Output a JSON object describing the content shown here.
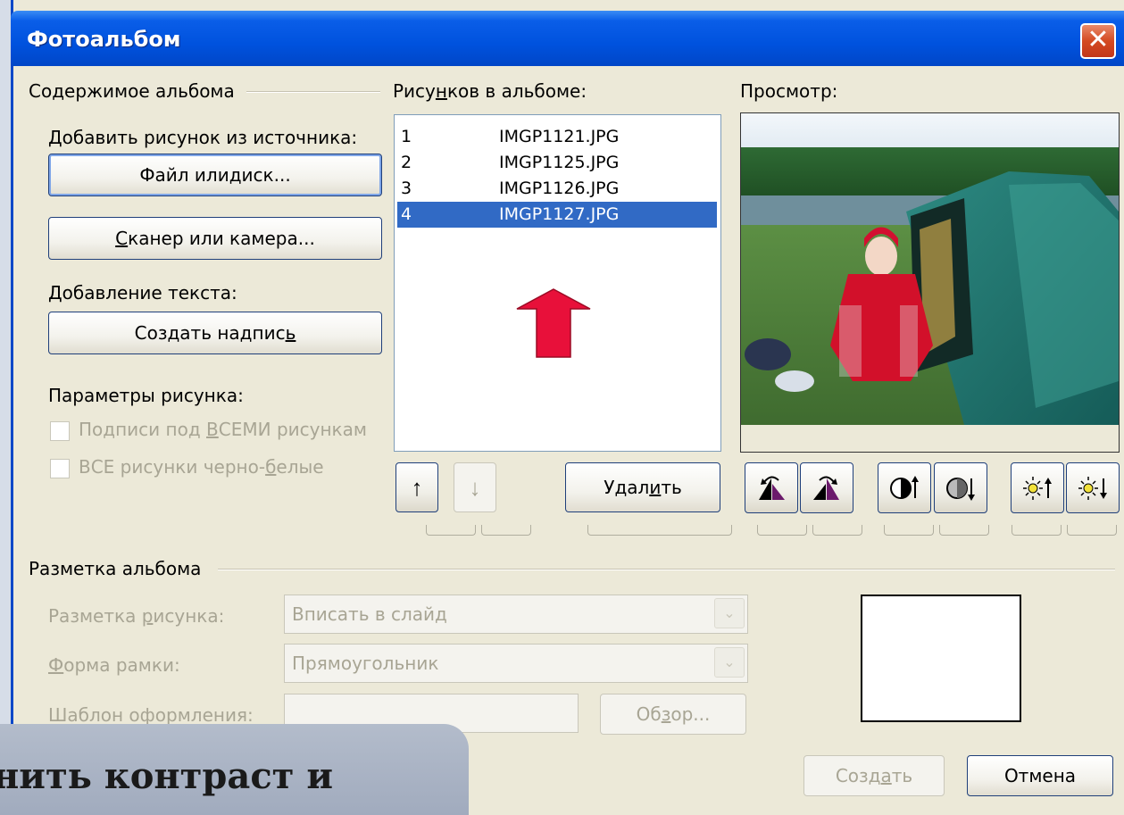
{
  "window": {
    "title": "Фотоальбом",
    "close_glyph": "✕"
  },
  "album_contents": {
    "heading": "Содержимое альбома",
    "add_from_label": "Добавить рисунок из источника:",
    "file_button": {
      "pre": "Файл или ",
      "ul": "д",
      "post": "иск..."
    },
    "scanner_button": {
      "pre": "",
      "ul": "С",
      "post": "канер или камера..."
    },
    "add_text_label": "Добавление текста:",
    "caption_button": {
      "pre": "Создать надпис",
      "ul": "ь",
      "post": ""
    },
    "picture_options_label": "Параметры рисунка:",
    "captions_checkbox": {
      "pre": "Подписи под ",
      "ul": "В",
      "post": "СЕМИ рисункам",
      "checked": false
    },
    "bw_checkbox": {
      "pre": "ВСЕ рисунки черно-",
      "ul": "б",
      "post": "елые",
      "checked": false
    }
  },
  "pictures": {
    "heading": {
      "pre": "Рису",
      "ul": "н",
      "post": "ков в альбоме:"
    },
    "items": [
      {
        "num": "1",
        "name": "IMGP1121.JPG",
        "selected": false
      },
      {
        "num": "2",
        "name": "IMGP1125.JPG",
        "selected": false
      },
      {
        "num": "3",
        "name": "IMGP1126.JPG",
        "selected": false
      },
      {
        "num": "4",
        "name": "IMGP1127.JPG",
        "selected": true
      }
    ],
    "move_up_glyph": "↑",
    "move_down_glyph": "↓",
    "delete_button": {
      "pre": "Удал",
      "ul": "и",
      "post": "ть"
    }
  },
  "preview": {
    "heading": "Просмотр:",
    "tools": [
      {
        "name": "rotate-left-icon",
        "enabled": true
      },
      {
        "name": "rotate-right-icon",
        "enabled": true
      },
      {
        "name": "contrast-up-icon",
        "enabled": true
      },
      {
        "name": "contrast-down-icon",
        "enabled": true
      },
      {
        "name": "brightness-up-icon",
        "enabled": true
      },
      {
        "name": "brightness-down-icon",
        "enabled": true
      }
    ]
  },
  "album_layout": {
    "heading": "Разметка альбома",
    "picture_layout_label": {
      "pre": "Разметка ",
      "ul": "р",
      "post": "исунка:"
    },
    "picture_layout_value": "Вписать в слайд",
    "frame_shape_label": {
      "pre": "",
      "ul": "Ф",
      "post": "орма рамки:"
    },
    "frame_shape_value": "Прямоугольник",
    "design_template_label": "Шаблон оформления:",
    "design_template_value": "",
    "browse_button": {
      "pre": "Об",
      "ul": "з",
      "post": "ор..."
    }
  },
  "footer": {
    "create_button": {
      "pre": "Созд",
      "ul": "а",
      "post": "ть"
    },
    "cancel_button": "Отмена"
  },
  "overlay": {
    "text": "нить контраст и"
  },
  "colors": {
    "title_bar": "#0052de",
    "selection": "#316ac5",
    "dialog_bg": "#ece9d8",
    "arrow_red": "#e8103a"
  }
}
